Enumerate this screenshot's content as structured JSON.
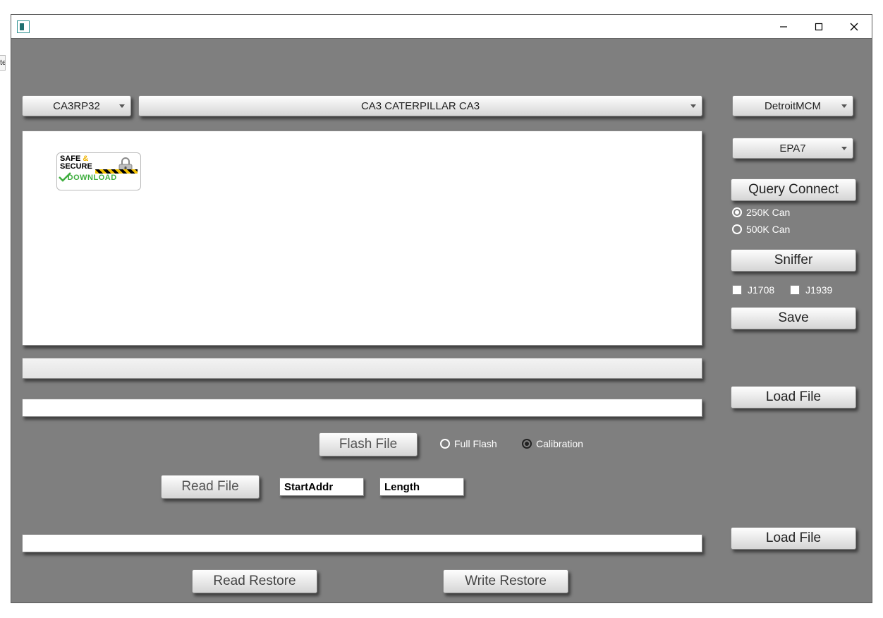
{
  "bg_tab_text": "ted",
  "top": {
    "left_dropdown": "CA3RP32",
    "center_dropdown": "CA3 CATERPILLAR CA3",
    "right_dropdown_1": "DetroitMCM",
    "right_dropdown_2": "EPA7"
  },
  "badge": {
    "line1_a": "SAFE",
    "line1_amp": "&",
    "line2": "SECURE",
    "line3": "DOWNLOAD"
  },
  "right_panel": {
    "query_connect": "Query Connect",
    "radio_250k": "250K Can",
    "radio_500k": "500K Can",
    "sniffer": "Sniffer",
    "check_j1708": "J1708",
    "check_j1939": "J1939",
    "save": "Save",
    "load_file_1": "Load File",
    "load_file_2": "Load File"
  },
  "flash": {
    "button": "Flash File",
    "radio_full": "Full Flash",
    "radio_cal": "Calibration"
  },
  "read": {
    "button": "Read File",
    "start_addr": "StartAddr",
    "length": "Length"
  },
  "restore": {
    "read": "Read Restore",
    "write": "Write Restore"
  }
}
